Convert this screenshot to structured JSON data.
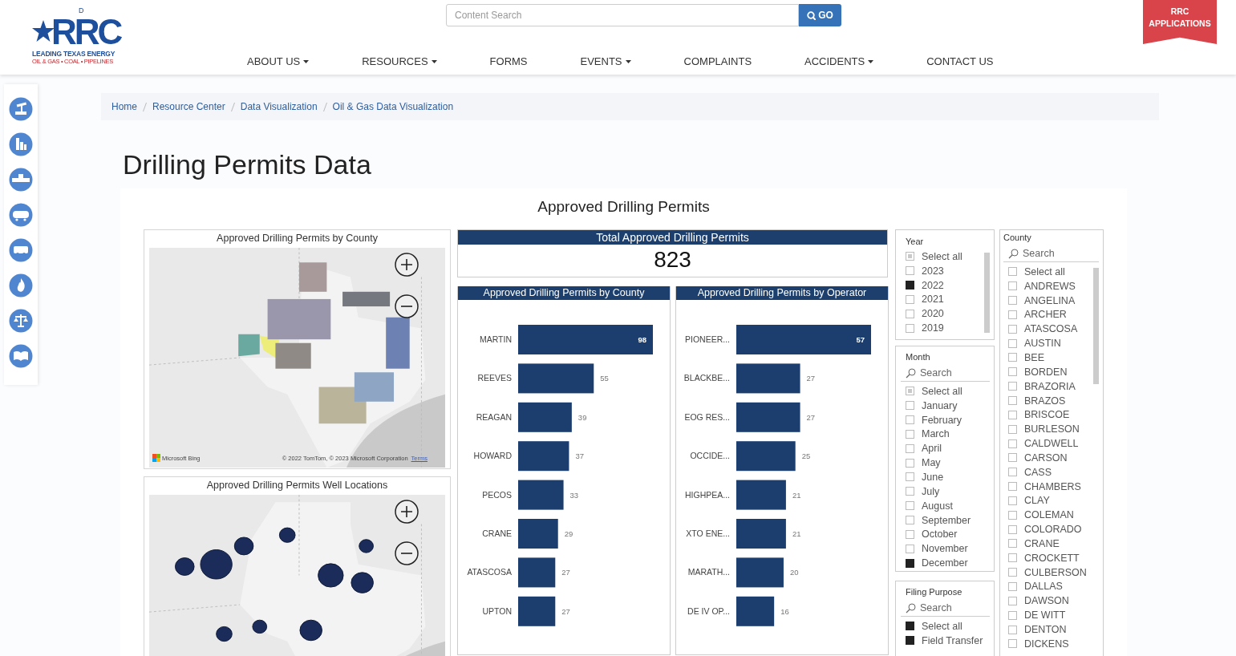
{
  "header": {
    "logo": {
      "wordmark": "RRC",
      "letter": "D",
      "tagline": "LEADING TEXAS ENERGY",
      "subline": "OIL & GAS • COAL • PIPELINES"
    },
    "search": {
      "placeholder": "Content Search",
      "button": "GO"
    },
    "apps_button": "RRC APPLICATIONS",
    "nav": [
      {
        "label": "ABOUT US",
        "dropdown": true
      },
      {
        "label": "RESOURCES",
        "dropdown": true
      },
      {
        "label": "FORMS",
        "dropdown": false
      },
      {
        "label": "EVENTS",
        "dropdown": true
      },
      {
        "label": "COMPLAINTS",
        "dropdown": false
      },
      {
        "label": "ACCIDENTS",
        "dropdown": true
      },
      {
        "label": "CONTACT US",
        "dropdown": false
      }
    ]
  },
  "breadcrumb": [
    "Home",
    "Resource Center",
    "Data Visualization",
    "Oil & Gas Data Visualization"
  ],
  "page_title": "Drilling Permits Data",
  "report": {
    "title": "Approved Drilling Permits",
    "county_map": {
      "title": "Approved Drilling Permits by County",
      "attribution": {
        "brand": "Microsoft Bing",
        "copyright": "© 2022 TomTom, © 2023 Microsoft Corporation",
        "link": "Terms"
      }
    },
    "well_map": {
      "title": "Approved Drilling Permits Well Locations"
    },
    "total_card": {
      "title": "Total Approved Drilling Permits",
      "value": "823"
    },
    "charts": [
      {
        "chart_data": {
          "type": "bar",
          "orientation": "horizontal",
          "title": "Approved Drilling Permits by County",
          "categories": [
            "MARTIN",
            "REEVES",
            "REAGAN",
            "HOWARD",
            "PECOS",
            "CRANE",
            "ATASCOSA",
            "UPTON"
          ],
          "data_labels": true,
          "series": [
            {
              "color": "#1b3e6f",
              "values": [
                98,
                55,
                39,
                37,
                33,
                29,
                27,
                27
              ]
            }
          ]
        }
      },
      {
        "chart_data": {
          "type": "bar",
          "orientation": "horizontal",
          "title": "Approved Drilling Permits by Operator",
          "categories": [
            "PIONEER...",
            "BLACKBE...",
            "EOG RES...",
            "OCCIDE...",
            "HIGHPEA...",
            "XTO ENE...",
            "MARATH...",
            "DE IV OP..."
          ],
          "data_labels": true,
          "series": [
            {
              "color": "#1b3e6f",
              "values": [
                57,
                27,
                27,
                25,
                21,
                21,
                20,
                16
              ]
            }
          ]
        }
      }
    ],
    "slicers": [
      {
        "title": "Year",
        "scrollbar": true,
        "items": [
          {
            "label": "Select all",
            "checked": false,
            "partial": true
          },
          {
            "label": "2023",
            "checked": false,
            "partial": false
          },
          {
            "label": "2022",
            "checked": true,
            "partial": false
          },
          {
            "label": "2021",
            "checked": false,
            "partial": false
          },
          {
            "label": "2020",
            "checked": false,
            "partial": false
          },
          {
            "label": "2019",
            "checked": false,
            "partial": false
          }
        ]
      },
      {
        "title": "Month",
        "search": {
          "placeholder": "Search"
        },
        "scrollbar": false,
        "items": [
          {
            "label": "Select all",
            "checked": false,
            "partial": true
          },
          {
            "label": "January",
            "checked": false,
            "partial": false
          },
          {
            "label": "February",
            "checked": false,
            "partial": false
          },
          {
            "label": "March",
            "checked": false,
            "partial": false
          },
          {
            "label": "April",
            "checked": false,
            "partial": false
          },
          {
            "label": "May",
            "checked": false,
            "partial": false
          },
          {
            "label": "June",
            "checked": false,
            "partial": false
          },
          {
            "label": "July",
            "checked": false,
            "partial": false
          },
          {
            "label": "August",
            "checked": false,
            "partial": false
          },
          {
            "label": "September",
            "checked": false,
            "partial": false
          },
          {
            "label": "October",
            "checked": false,
            "partial": false
          },
          {
            "label": "November",
            "checked": false,
            "partial": false
          },
          {
            "label": "December",
            "checked": true,
            "partial": false
          }
        ]
      },
      {
        "title": "Filing Purpose",
        "search": {
          "placeholder": "Search"
        },
        "scrollbar": false,
        "items": [
          {
            "label": "Select all",
            "checked": true,
            "partial": false
          },
          {
            "label": "Field Transfer",
            "checked": true,
            "partial": false
          }
        ]
      },
      {
        "title": "County",
        "search": {
          "placeholder": "Search"
        },
        "scrollbar": true,
        "items": [
          {
            "label": "Select all",
            "checked": false,
            "partial": false
          },
          {
            "label": "ANDREWS",
            "checked": false,
            "partial": false
          },
          {
            "label": "ANGELINA",
            "checked": false,
            "partial": false
          },
          {
            "label": "ARCHER",
            "checked": false,
            "partial": false
          },
          {
            "label": "ATASCOSA",
            "checked": false,
            "partial": false
          },
          {
            "label": "AUSTIN",
            "checked": false,
            "partial": false
          },
          {
            "label": "BEE",
            "checked": false,
            "partial": false
          },
          {
            "label": "BORDEN",
            "checked": false,
            "partial": false
          },
          {
            "label": "BRAZORIA",
            "checked": false,
            "partial": false
          },
          {
            "label": "BRAZOS",
            "checked": false,
            "partial": false
          },
          {
            "label": "BRISCOE",
            "checked": false,
            "partial": false
          },
          {
            "label": "BURLESON",
            "checked": false,
            "partial": false
          },
          {
            "label": "CALDWELL",
            "checked": false,
            "partial": false
          },
          {
            "label": "CARSON",
            "checked": false,
            "partial": false
          },
          {
            "label": "CASS",
            "checked": false,
            "partial": false
          },
          {
            "label": "CHAMBERS",
            "checked": false,
            "partial": false
          },
          {
            "label": "CLAY",
            "checked": false,
            "partial": false
          },
          {
            "label": "COLEMAN",
            "checked": false,
            "partial": false
          },
          {
            "label": "COLORADO",
            "checked": false,
            "partial": false
          },
          {
            "label": "CRANE",
            "checked": false,
            "partial": false
          },
          {
            "label": "CROCKETT",
            "checked": false,
            "partial": false
          },
          {
            "label": "CULBERSON",
            "checked": false,
            "partial": false
          },
          {
            "label": "DALLAS",
            "checked": false,
            "partial": false
          },
          {
            "label": "DAWSON",
            "checked": false,
            "partial": false
          },
          {
            "label": "DE WITT",
            "checked": false,
            "partial": false
          },
          {
            "label": "DENTON",
            "checked": false,
            "partial": false
          },
          {
            "label": "DICKENS",
            "checked": false,
            "partial": false
          }
        ]
      }
    ]
  }
}
